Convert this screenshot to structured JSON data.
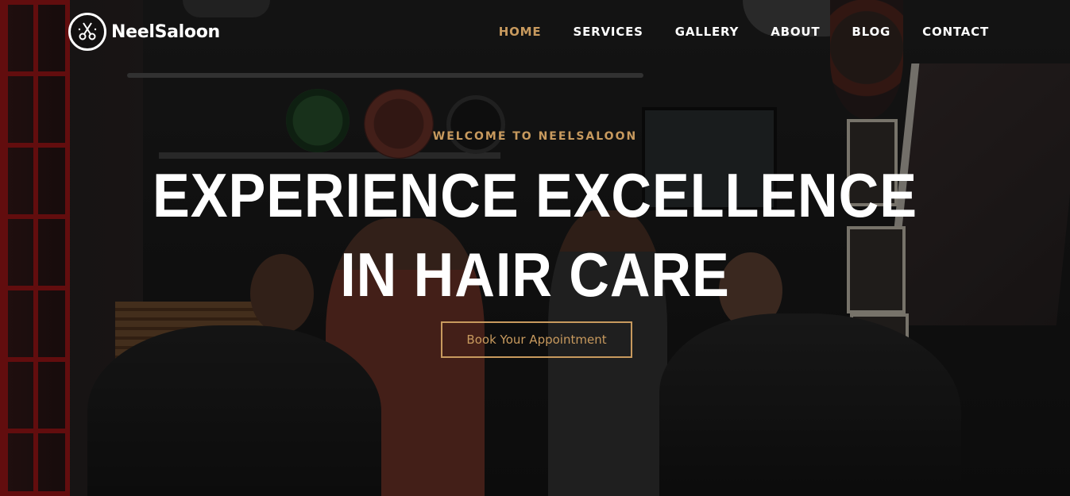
{
  "brand": {
    "name": "NeelSaloon",
    "icon": "scissors-comb-icon",
    "accent_color": "#c89a5e"
  },
  "nav": {
    "items": [
      {
        "label": "HOME",
        "active": true
      },
      {
        "label": "SERVICES",
        "active": false
      },
      {
        "label": "GALLERY",
        "active": false
      },
      {
        "label": "ABOUT",
        "active": false
      },
      {
        "label": "BLOG",
        "active": false
      },
      {
        "label": "CONTACT",
        "active": false
      }
    ]
  },
  "hero": {
    "eyebrow": "WELCOME TO NEELSALOON",
    "headline": "EXPERIENCE EXCELLENCE IN HAIR CARE",
    "cta_label": "Book Your Appointment",
    "background": "barbershop-photo"
  }
}
